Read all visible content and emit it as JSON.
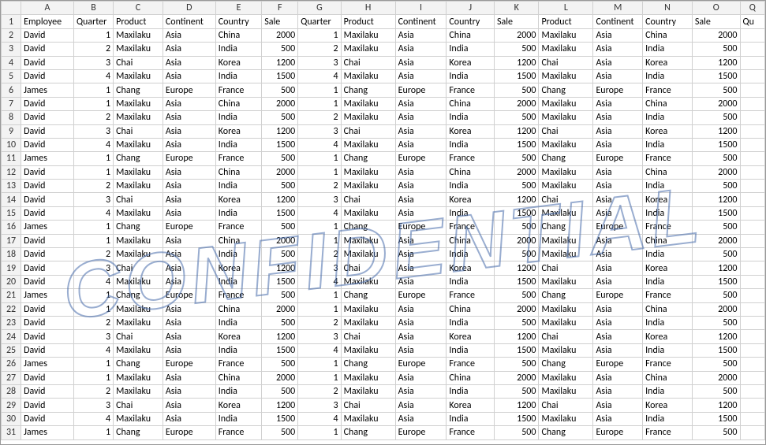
{
  "columns": [
    "A",
    "B",
    "C",
    "D",
    "E",
    "F",
    "G",
    "H",
    "I",
    "J",
    "K",
    "L",
    "M",
    "N",
    "O",
    "Q"
  ],
  "headerRow": [
    "Employee",
    "Quarter",
    "Product",
    "Continent",
    "Country",
    "Sale",
    "Quarter",
    "Product",
    "Continent",
    "Country",
    "Sale",
    "Product",
    "Continent",
    "Country",
    "Sale",
    "Qu"
  ],
  "numericCols": [
    1,
    5,
    6,
    10,
    14
  ],
  "baseRows": [
    [
      "David",
      "1",
      "Maxilaku",
      "Asia",
      "China",
      "2000",
      "1",
      "Maxilaku",
      "Asia",
      "China",
      "2000",
      "Maxilaku",
      "Asia",
      "China",
      "2000",
      ""
    ],
    [
      "David",
      "2",
      "Maxilaku",
      "Asia",
      "India",
      "500",
      "2",
      "Maxilaku",
      "Asia",
      "India",
      "500",
      "Maxilaku",
      "Asia",
      "India",
      "500",
      ""
    ],
    [
      "David",
      "3",
      "Chai",
      "Asia",
      "Korea",
      "1200",
      "3",
      "Chai",
      "Asia",
      "Korea",
      "1200",
      "Chai",
      "Asia",
      "Korea",
      "1200",
      ""
    ],
    [
      "David",
      "4",
      "Maxilaku",
      "Asia",
      "India",
      "1500",
      "4",
      "Maxilaku",
      "Asia",
      "India",
      "1500",
      "Maxilaku",
      "Asia",
      "India",
      "1500",
      ""
    ],
    [
      "James",
      "1",
      "Chang",
      "Europe",
      "France",
      "500",
      "1",
      "Chang",
      "Europe",
      "France",
      "500",
      "Chang",
      "Europe",
      "France",
      "500",
      ""
    ]
  ],
  "totalDataRows": 30,
  "watermark": "CONFIDENTIAL"
}
